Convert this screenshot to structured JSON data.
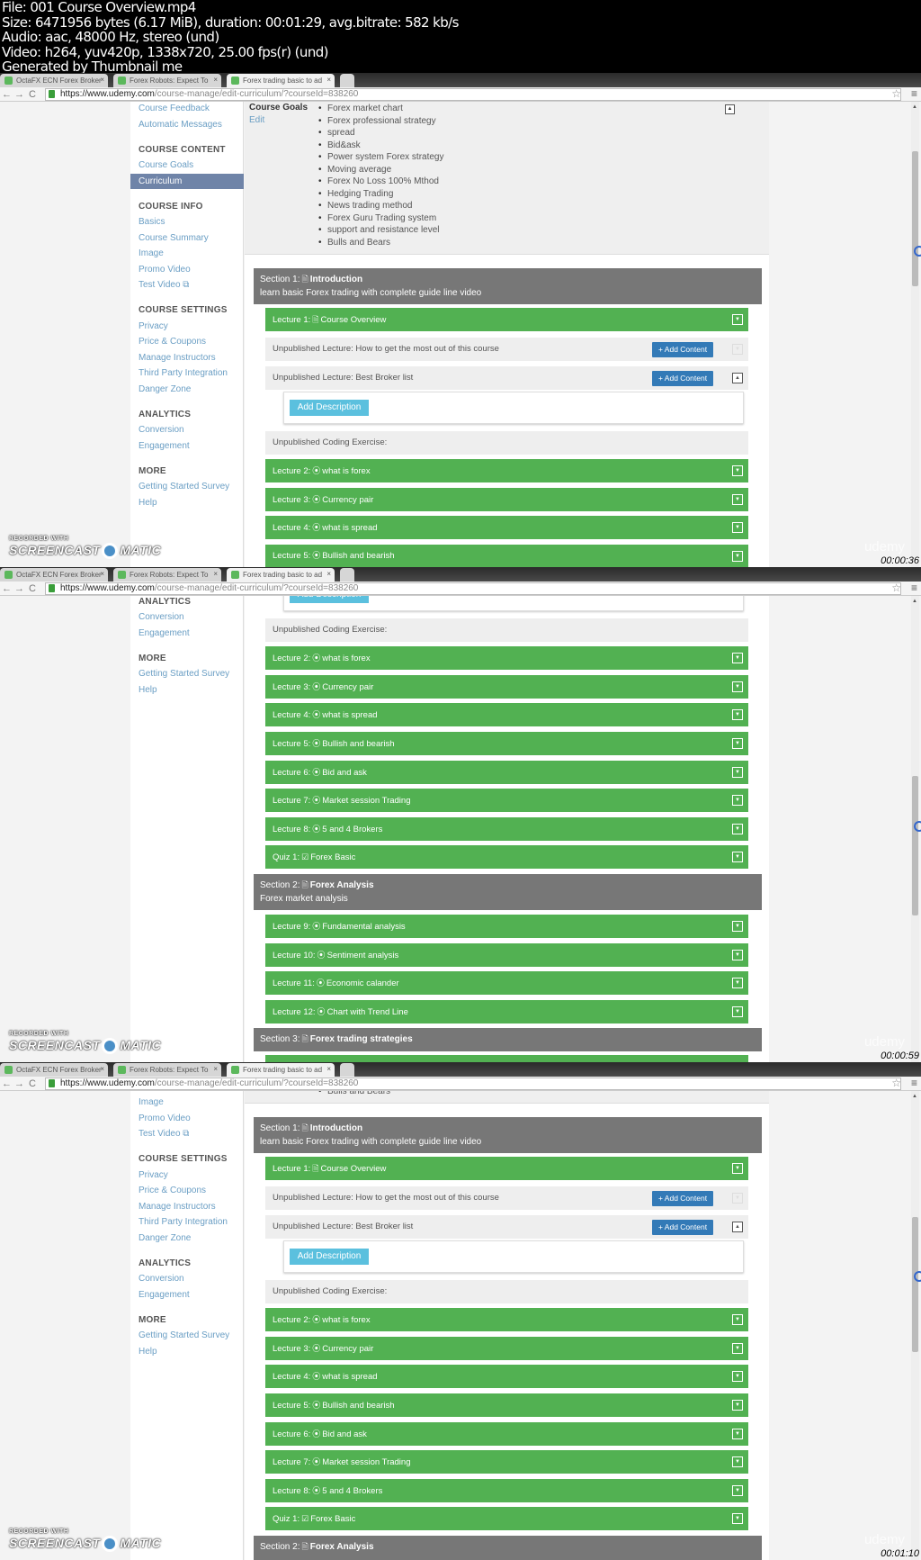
{
  "file_info": [
    "File: 001 Course Overview.mp4",
    "Size: 6471956 bytes (6.17 MiB), duration: 00:01:29, avg.bitrate: 582 kb/s",
    "Audio: aac, 48000 Hz, stereo (und)",
    "Video: h264, yuv420p, 1338x720, 25.00 fps(r) (und)",
    "Generated by Thumbnail me"
  ],
  "browser": {
    "tabs": [
      {
        "label": "OctaFX ECN Forex Broker",
        "active": false
      },
      {
        "label": "Forex Robots: Expect To",
        "active": false
      },
      {
        "label": "Forex trading basic to ad",
        "active": true
      }
    ],
    "url_host": "https://www.udemy.com",
    "url_path": "/course-manage/edit-curriculum/?courseId=838260"
  },
  "sidebar": [
    {
      "heading": "",
      "items": [
        {
          "label": "Course Feedback"
        },
        {
          "label": "Automatic Messages"
        }
      ]
    },
    {
      "heading": "COURSE CONTENT",
      "items": [
        {
          "label": "Course Goals"
        },
        {
          "label": "Curriculum",
          "active": true
        }
      ]
    },
    {
      "heading": "COURSE INFO",
      "items": [
        {
          "label": "Basics"
        },
        {
          "label": "Course Summary"
        },
        {
          "label": "Image"
        },
        {
          "label": "Promo Video"
        },
        {
          "label": "Test Video",
          "external": true
        }
      ]
    },
    {
      "heading": "COURSE SETTINGS",
      "items": [
        {
          "label": "Privacy"
        },
        {
          "label": "Price & Coupons"
        },
        {
          "label": "Manage Instructors"
        },
        {
          "label": "Third Party Integration"
        },
        {
          "label": "Danger Zone"
        }
      ]
    },
    {
      "heading": "ANALYTICS",
      "items": [
        {
          "label": "Conversion"
        },
        {
          "label": "Engagement"
        }
      ]
    },
    {
      "heading": "MORE",
      "items": [
        {
          "label": "Getting Started Survey"
        },
        {
          "label": "Help"
        }
      ]
    }
  ],
  "course_goals": {
    "label": "Course Goals",
    "edit_label": "Edit",
    "items": [
      "Forex market chart",
      "Forex professional strategy",
      "spread",
      "Bid&ask",
      "Power system Forex strategy",
      "Moving average",
      "Forex No Loss 100% Mthod",
      "Hedging Trading",
      "News trading method",
      "Forex Guru Trading system",
      "support and resistance level",
      "Bulls and Bears"
    ]
  },
  "curriculum": [
    {
      "type": "section",
      "prefix": "Section 1:",
      "title": "Introduction",
      "subtitle": "learn basic Forex trading with complete guide line video"
    },
    {
      "type": "lecture",
      "prefix": "Lecture 1:",
      "icon": "file-icon",
      "title": "Course Overview"
    },
    {
      "type": "unpublished",
      "text": "Unpublished Lecture: How to get the most out of this course",
      "button": "+ Add Content",
      "toggle_faint": true
    },
    {
      "type": "unpublished",
      "text": "Unpublished Lecture: Best Broker list",
      "button": "+ Add Content",
      "expanded": true
    },
    {
      "type": "description",
      "button": "Add Description"
    },
    {
      "type": "coding",
      "text": "Unpublished Coding Exercise:"
    },
    {
      "type": "lecture",
      "prefix": "Lecture 2:",
      "icon": "play-circle-icon",
      "title": "what is forex"
    },
    {
      "type": "lecture",
      "prefix": "Lecture 3:",
      "icon": "play-circle-icon",
      "title": "Currency pair"
    },
    {
      "type": "lecture",
      "prefix": "Lecture 4:",
      "icon": "play-circle-icon",
      "title": "what is spread"
    },
    {
      "type": "lecture",
      "prefix": "Lecture 5:",
      "icon": "play-circle-icon",
      "title": "Bullish and bearish"
    },
    {
      "type": "lecture",
      "prefix": "Lecture 6:",
      "icon": "play-circle-icon",
      "title": "Bid and ask"
    },
    {
      "type": "lecture",
      "prefix": "Lecture 7:",
      "icon": "play-circle-icon",
      "title": "Market session Trading"
    },
    {
      "type": "lecture",
      "prefix": "Lecture 8:",
      "icon": "play-circle-icon",
      "title": "5 and 4 Brokers"
    },
    {
      "type": "lecture",
      "prefix": "Quiz 1:",
      "icon": "check-square-icon",
      "title": "Forex Basic"
    },
    {
      "type": "section",
      "prefix": "Section 2:",
      "title": "Forex Analysis",
      "subtitle": "Forex market analysis"
    },
    {
      "type": "lecture",
      "prefix": "Lecture 9:",
      "icon": "play-circle-icon",
      "title": "Fundamental analysis"
    },
    {
      "type": "lecture",
      "prefix": "Lecture 10:",
      "icon": "play-circle-icon",
      "title": "Sentiment analysis"
    },
    {
      "type": "lecture",
      "prefix": "Lecture 11:",
      "icon": "play-circle-icon",
      "title": "Economic calander"
    },
    {
      "type": "lecture",
      "prefix": "Lecture 12:",
      "icon": "play-circle-icon",
      "title": "Chart with Trend Line"
    },
    {
      "type": "section",
      "prefix": "Section 3:",
      "title": "Forex trading strategies",
      "subtitle": ""
    },
    {
      "type": "lecture",
      "prefix": "",
      "icon": "",
      "title": ""
    }
  ],
  "watermark": {
    "recorded_with": "RECORDED WITH",
    "brand_left": "SCREENCAST",
    "brand_right": "MATIC",
    "udemy": "udemy"
  },
  "frames": [
    {
      "timestamp": "00:00:36"
    },
    {
      "timestamp": "00:00:59"
    },
    {
      "timestamp": "00:01:10"
    }
  ],
  "colors": {
    "lecture_green": "#52b152",
    "section_gray": "#777777",
    "add_content_blue": "#337ab7",
    "add_description_cyan": "#5bc0de",
    "sidebar_active": "#6f84a8"
  }
}
